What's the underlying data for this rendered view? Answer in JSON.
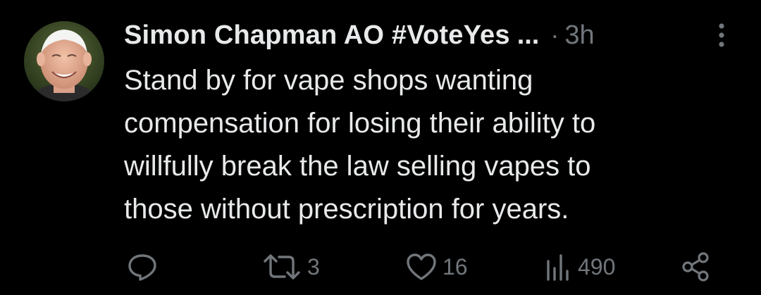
{
  "author": {
    "display_name": "Simon Chapman AO #VoteYes",
    "truncation": "...",
    "separator": "·",
    "timestamp": "3h"
  },
  "tweet": {
    "text": "Stand by for vape shops wanting\ncompensation for losing their ability to\nwillfully break the law selling vapes to\nthose without prescription for years."
  },
  "actions": {
    "reply_count": "",
    "retweet_count": "3",
    "like_count": "16",
    "views_count": "490"
  },
  "icons": {
    "more": "more-vertical-icon",
    "reply": "reply-icon",
    "retweet": "retweet-icon",
    "like": "heart-icon",
    "views": "views-icon",
    "share": "share-icon"
  },
  "colors": {
    "background": "#000000",
    "text_primary": "#e7e9ea",
    "text_secondary": "#71767b"
  }
}
